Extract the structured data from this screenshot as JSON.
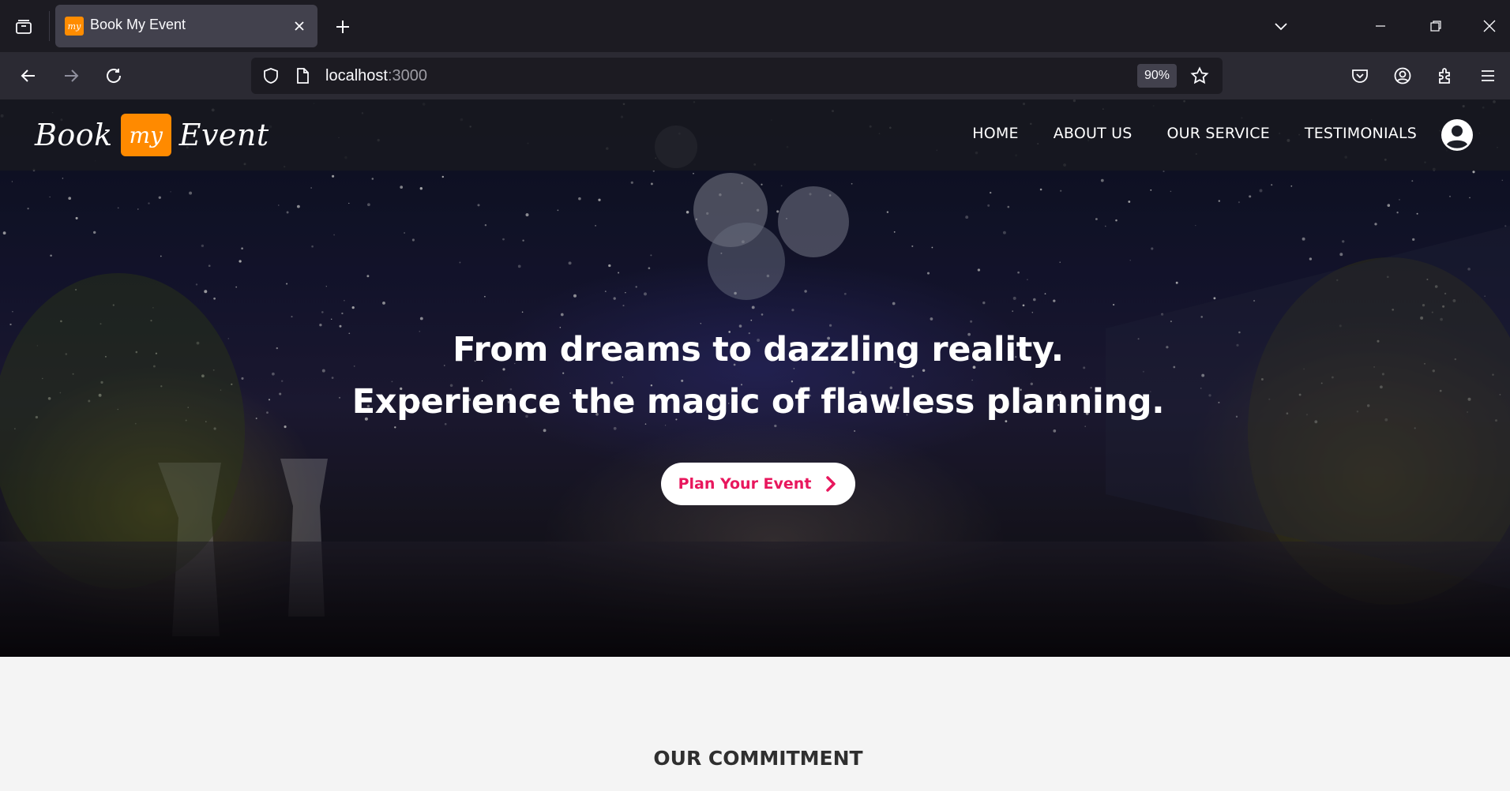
{
  "browser": {
    "tab": {
      "title": "Book My Event",
      "favicon_text": "my"
    },
    "url": {
      "host": "localhost",
      "port": ":3000"
    },
    "zoom": "90%",
    "icons": [
      "tab-list-icon",
      "close-icon",
      "plus-icon",
      "chevron-down-icon",
      "minimize-icon",
      "restore-icon",
      "window-close-icon",
      "back-arrow-icon",
      "forward-arrow-icon",
      "reload-icon",
      "shield-icon",
      "page-icon",
      "star-icon",
      "pocket-icon",
      "account-icon",
      "extensions-icon",
      "menu-icon"
    ]
  },
  "site": {
    "logo": {
      "left": "Book",
      "middle": "my",
      "right": "Event"
    },
    "nav": [
      {
        "label": "HOME"
      },
      {
        "label": "ABOUT US"
      },
      {
        "label": "OUR SERVICE"
      },
      {
        "label": "TESTIMONIALS"
      }
    ],
    "hero": {
      "line1": "From dreams to dazzling reality.",
      "line2": "Experience the magic of flawless planning.",
      "cta": "Plan Your Event"
    },
    "section_heading": "OUR COMMITMENT"
  },
  "colors": {
    "accent": "#ff8a00",
    "cta_text": "#e8175d",
    "chrome_dark": "#1c1b22",
    "chrome_toolbar": "#2b2a33"
  }
}
